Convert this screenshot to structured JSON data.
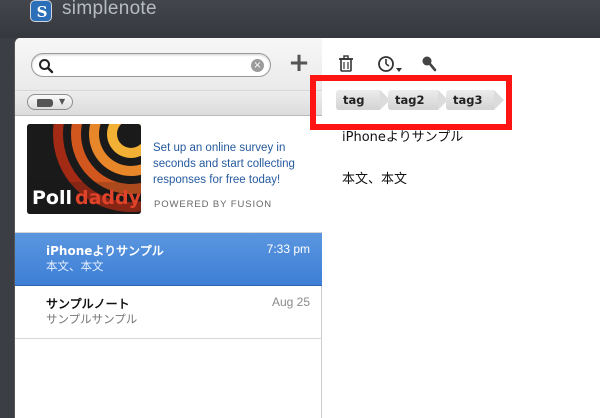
{
  "app": {
    "title": "simplenote",
    "logo_letter": "S"
  },
  "search": {
    "placeholder": "",
    "value": ""
  },
  "ad": {
    "brand": "Polldaddy",
    "text": "Set up an online survey in seconds and start collecting responses for free today!",
    "powered": "POWERED BY FUSION"
  },
  "notes": [
    {
      "title": "iPhoneよりサンプル",
      "preview": "本文、本文",
      "date": "7:33 pm",
      "selected": true
    },
    {
      "title": "サンプルノート",
      "preview": "サンプルサンプル",
      "date": "Aug 25",
      "selected": false
    }
  ],
  "editor": {
    "tags": [
      "tag",
      "tag2",
      "tag3"
    ],
    "lines": [
      "iPhoneよりサンプル",
      "本文、本文"
    ]
  },
  "colors": {
    "accent": "#3d7fd6",
    "highlight": "#ff1414"
  }
}
